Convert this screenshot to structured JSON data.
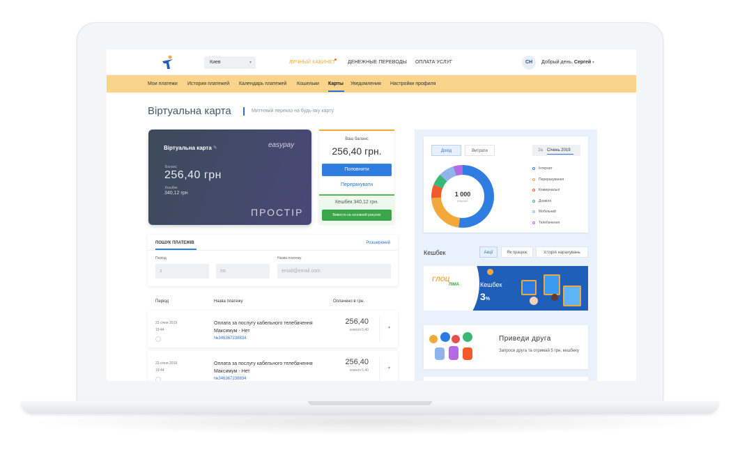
{
  "header": {
    "city": "Киев",
    "nav": [
      {
        "label": "ЛИЧНЫЙ КАБИНЕТ",
        "active": true
      },
      {
        "label": "ДЕНЕЖНЫЕ ПЕРЕВОДЫ",
        "active": false
      },
      {
        "label": "ОПЛАТА УСЛУГ",
        "active": false
      }
    ],
    "avatar_initials": "СН",
    "greeting": "Добрый день,",
    "user_name": "Сергей"
  },
  "subnav": {
    "items": [
      {
        "label": "Мои платежи"
      },
      {
        "label": "История платежей"
      },
      {
        "label": "Календарь платежей"
      },
      {
        "label": "Кошельки"
      },
      {
        "label": "Карты",
        "active": true
      },
      {
        "label": "Уведомления"
      },
      {
        "label": "Настройки профиля"
      }
    ]
  },
  "page": {
    "title": "Віртуальна карта",
    "subtitle": "Миттевий переказ на будь-яку карту"
  },
  "card": {
    "title": "Віртуальна карта",
    "brand": "easypay",
    "balance_label": "Баланс",
    "balance": "256,40 грн",
    "cashback_label": "Кешбек",
    "cashback": "340,12 грн",
    "logo": "ПРОСТІР"
  },
  "balance_panel": {
    "label": "Ваш баланс",
    "amount": "256,40 грн.",
    "topup_button": "Поповнити",
    "transfer_link": "Перерахувати",
    "cashback": "Кешбек 340,12 грн.",
    "withdraw_button": "Вивести на основний рахунок"
  },
  "search": {
    "title": "ПОШУК ПЛАТЕЖІВ",
    "advanced": "Розширений",
    "period_label": "Період",
    "from_placeholder": "з",
    "to_placeholder": "по",
    "name_label": "Назва платежу",
    "name_placeholder": "email@email.com"
  },
  "table": {
    "headers": [
      "Період",
      "Назва платежу",
      "Оплачено в грн."
    ],
    "rows": [
      {
        "date": "23 січня 2019",
        "time": "19:44",
        "name1": "Оплата за послугу кабельного телебачення",
        "name2": "Максимум - Нет",
        "number": "№346367238834",
        "amount": "256,40",
        "commission": "комісія 5,40"
      },
      {
        "date": "23 січня 2019",
        "time": "19:44",
        "name1": "Оплата за послугу кабельного телебачення",
        "name2": "Максимум - Нет",
        "number": "№346367238834",
        "amount": "256,40",
        "commission": "комісія 5,40"
      }
    ]
  },
  "stats": {
    "tab_income": "Дохід",
    "tab_expense": "Витрати",
    "period_prefix": "За",
    "period_month": "Січень 2019",
    "total": "1 000",
    "total_label": "Інтернет",
    "legend": [
      {
        "label": "Інтернет",
        "color": "#2f7de1"
      },
      {
        "label": "Перерахування",
        "color": "#f2a93b"
      },
      {
        "label": "Коммунальні",
        "color": "#f25a2a"
      },
      {
        "label": "Дозвілл",
        "color": "#3ab877"
      },
      {
        "label": "Мобільний",
        "color": "#8fb3ea"
      },
      {
        "label": "Телебачення",
        "color": "#b26be0"
      }
    ],
    "donut_values": [
      52,
      22,
      7,
      6,
      8,
      5
    ]
  },
  "cashback": {
    "title": "Кешбек",
    "tabs": [
      {
        "label": "Акції",
        "active": true
      },
      {
        "label": "Як працює"
      },
      {
        "label": "Історія нарахувань"
      }
    ],
    "banner_logo": "ГЛОЦ",
    "banner_logo_sub": "ЛІМА",
    "banner_title": "Кешбек",
    "banner_value": "3",
    "banner_unit": "%"
  },
  "referral": {
    "title": "Приведи друга",
    "text": "Запроси друга та отримай 5 грн. кешбеку"
  }
}
